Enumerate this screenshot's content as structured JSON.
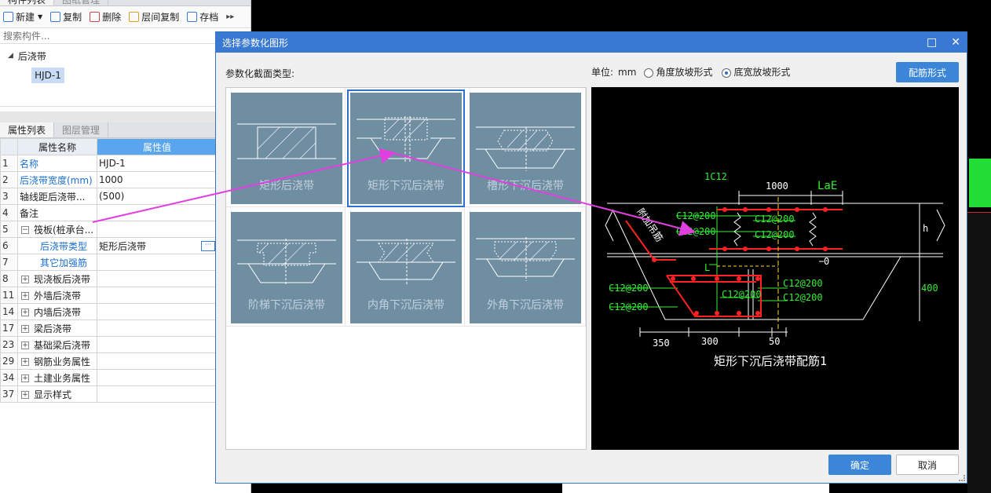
{
  "left_panel": {
    "top_tabs": [
      "构件列表",
      "图纸管理"
    ],
    "toolbar": {
      "new_label": "新建",
      "copy_label": "复制",
      "delete_label": "删除",
      "floor_copy_label": "层间复制",
      "archive_label": "存档"
    },
    "search": {
      "placeholder": "搜索构件..."
    },
    "tree": {
      "root_label": "后浇带",
      "child_label": "HJD-1"
    },
    "prop_tabs": [
      "属性列表",
      "图层管理"
    ],
    "table": {
      "header_name": "属性名称",
      "header_value": "属性值",
      "rows": [
        {
          "num": "1",
          "name": "名称",
          "value": "HJD-1"
        },
        {
          "num": "2",
          "name": "后浇带宽度(mm)",
          "value": "1000"
        },
        {
          "num": "3",
          "name": "轴线距后浇带...",
          "value": "(500)"
        },
        {
          "num": "4",
          "name": "备注",
          "value": ""
        },
        {
          "num": "5",
          "name": "筏板(桩承台...",
          "value": ""
        },
        {
          "num": "6",
          "name": "后浇带类型",
          "value": "矩形后浇带"
        },
        {
          "num": "7",
          "name": "其它加强筋",
          "value": ""
        },
        {
          "num": "8",
          "name": "现浇板后浇带",
          "value": ""
        },
        {
          "num": "11",
          "name": "外墙后浇带",
          "value": ""
        },
        {
          "num": "14",
          "name": "内墙后浇带",
          "value": ""
        },
        {
          "num": "17",
          "name": "梁后浇带",
          "value": ""
        },
        {
          "num": "23",
          "name": "基础梁后浇带",
          "value": ""
        },
        {
          "num": "29",
          "name": "钢筋业务属性",
          "value": ""
        },
        {
          "num": "34",
          "name": "土建业务属性",
          "value": ""
        },
        {
          "num": "37",
          "name": "显示样式",
          "value": ""
        }
      ]
    }
  },
  "dialog": {
    "title": "选择参数化图形",
    "section_label": "参数化截面类型:",
    "unit_label": "单位:",
    "unit_value": "mm",
    "radio_angle": "角度放坡形式",
    "radio_width": "底宽放坡形式",
    "rebar_form_button": "配筋形式",
    "shapes": [
      "矩形后浇带",
      "矩形下沉后浇带",
      "槽形下沉后浇带",
      "阶梯下沉后浇带",
      "内角下沉后浇带",
      "外角下沉后浇带"
    ],
    "preview": {
      "caption": "矩形下沉后浇带配筋1",
      "labels": {
        "top_bar": "1C12",
        "width": "1000",
        "lae": "LaE",
        "r1": "C12@200",
        "r2": "C12@200",
        "r3": "C12@200",
        "r4": "C12@200",
        "r5": "C12@200",
        "r6": "C12@200",
        "r7": "C12@200",
        "r8": "C12@200",
        "r9": "C12@200",
        "diag": "附加吊筋",
        "h": "h",
        "zero": "0",
        "l": "L",
        "depth": "400",
        "d350": "350",
        "d300": "300",
        "d50": "50"
      }
    },
    "ok_button": "确定",
    "cancel_button": "取消"
  },
  "colors": {
    "accent": "#3979d3",
    "arrow": "#e040e0",
    "dim_green": "#33ee33",
    "rebar_red": "#ff2222"
  }
}
